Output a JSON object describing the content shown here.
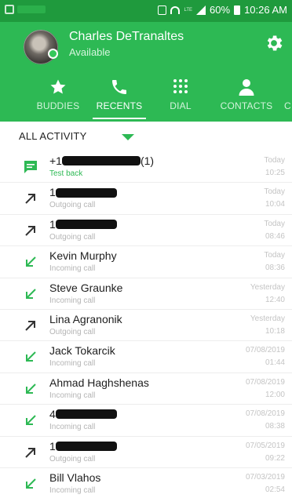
{
  "status_bar": {
    "battery": "60%",
    "time": "10:26 AM",
    "network": "LTE"
  },
  "profile": {
    "name": "Charles DeTranaltes",
    "status": "Available"
  },
  "tabs": [
    {
      "label": "BUDDIES",
      "icon": "star-icon",
      "active": false
    },
    {
      "label": "RECENTS",
      "icon": "phone-icon",
      "active": true
    },
    {
      "label": "DIAL",
      "icon": "dialpad-icon",
      "active": false
    },
    {
      "label": "CONTACTS",
      "icon": "person-icon",
      "active": false
    },
    {
      "label": "C",
      "icon": "",
      "active": false
    }
  ],
  "filter": {
    "label": "ALL ACTIVITY"
  },
  "colors": {
    "status_bar": "#1f9a3d",
    "header": "#2db954",
    "incoming": "#2db954",
    "outgoing": "#333333"
  },
  "recents": [
    {
      "type": "message",
      "name_prefix": "+1",
      "name_suffix": "(1)",
      "redacted": true,
      "subtitle": "Test back",
      "date": "Today",
      "time": "10:25"
    },
    {
      "type": "outgoing",
      "name_prefix": "1",
      "name_suffix": "",
      "redacted": true,
      "subtitle": "Outgoing call",
      "date": "Today",
      "time": "10:04"
    },
    {
      "type": "outgoing",
      "name_prefix": "1",
      "name_suffix": "",
      "redacted": true,
      "subtitle": "Outgoing call",
      "date": "Today",
      "time": "08:46"
    },
    {
      "type": "incoming",
      "name_prefix": "Kevin Murphy",
      "name_suffix": "",
      "redacted": false,
      "subtitle": "Incoming call",
      "date": "Today",
      "time": "08:36"
    },
    {
      "type": "incoming",
      "name_prefix": "Steve Graunke",
      "name_suffix": "",
      "redacted": false,
      "subtitle": "Incoming call",
      "date": "Yesterday",
      "time": "12:40"
    },
    {
      "type": "outgoing",
      "name_prefix": "Lina Agranonik",
      "name_suffix": "",
      "redacted": false,
      "subtitle": "Outgoing call",
      "date": "Yesterday",
      "time": "10:18"
    },
    {
      "type": "incoming",
      "name_prefix": "Jack Tokarcik",
      "name_suffix": "",
      "redacted": false,
      "subtitle": "Incoming call",
      "date": "07/08/2019",
      "time": "01:44"
    },
    {
      "type": "incoming",
      "name_prefix": "Ahmad Haghshenas",
      "name_suffix": "",
      "redacted": false,
      "subtitle": "Incoming call",
      "date": "07/08/2019",
      "time": "12:00"
    },
    {
      "type": "incoming",
      "name_prefix": "4",
      "name_suffix": "",
      "redacted": true,
      "subtitle": "Incoming call",
      "date": "07/08/2019",
      "time": "08:38"
    },
    {
      "type": "outgoing",
      "name_prefix": "1",
      "name_suffix": "",
      "redacted": true,
      "subtitle": "Outgoing call",
      "date": "07/05/2019",
      "time": "09:22"
    },
    {
      "type": "incoming",
      "name_prefix": "Bill Vlahos",
      "name_suffix": "",
      "redacted": false,
      "subtitle": "Incoming call",
      "date": "07/03/2019",
      "time": "02:54"
    }
  ]
}
